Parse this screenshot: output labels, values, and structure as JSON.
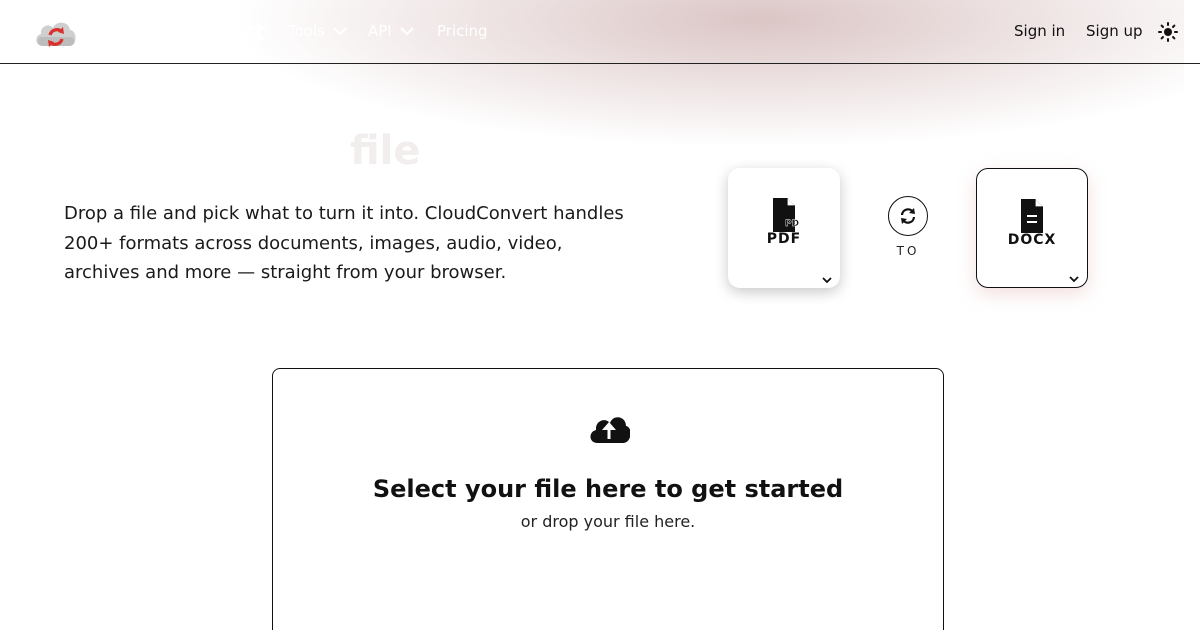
{
  "brand": {
    "name": "cloudconvert"
  },
  "nav": {
    "links": [
      {
        "label": "Tools"
      },
      {
        "label": "API"
      },
      {
        "label": "Pricing"
      }
    ],
    "sign_in": "Sign in",
    "sign_up": "Sign up"
  },
  "hero": {
    "title": "file",
    "description": "Drop a file and pick what to turn it into. CloudConvert handles 200+ formats across documents, images, audio, video, archives and more — straight from your browser."
  },
  "converter": {
    "from_format": "PDF",
    "to_format": "DOCX",
    "to_label": "TO",
    "icons": {
      "from": "file-pdf-icon",
      "to": "file-docx-icon",
      "swap": "refresh-icon"
    }
  },
  "dropzone": {
    "title": "Select your file here to get started",
    "subtitle": "or drop your file here.",
    "icon": "cloud-upload-icon"
  },
  "colors": {
    "brand_red": "#d9302c",
    "text": "#111111",
    "glow": "#be9696"
  }
}
